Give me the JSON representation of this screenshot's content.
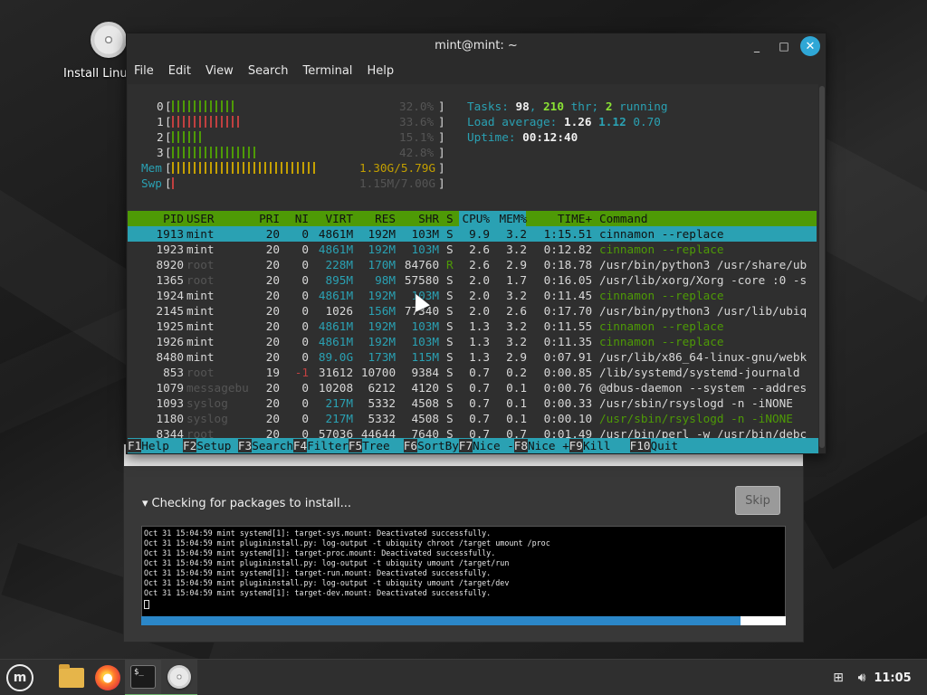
{
  "desktop": {
    "icon_label": "Install Linux Mint"
  },
  "installer": {
    "status": "Checking for packages to install...",
    "skip_label": "Skip",
    "progress_fraction": 0.93,
    "log": [
      "Oct 31 15:04:59 mint systemd[1]: target-sys.mount: Deactivated successfully.",
      "Oct 31 15:04:59 mint plugininstall.py: log-output -t ubiquity chroot /target umount /proc",
      "Oct 31 15:04:59 mint systemd[1]: target-proc.mount: Deactivated successfully.",
      "Oct 31 15:04:59 mint plugininstall.py: log-output -t ubiquity umount /target/run",
      "Oct 31 15:04:59 mint systemd[1]: target-run.mount: Deactivated successfully.",
      "Oct 31 15:04:59 mint plugininstall.py: log-output -t ubiquity umount /target/dev",
      "Oct 31 15:04:59 mint systemd[1]: target-dev.mount: Deactivated successfully."
    ]
  },
  "terminal": {
    "title": "mint@mint: ~",
    "menu": [
      "File",
      "Edit",
      "View",
      "Search",
      "Terminal",
      "Help"
    ]
  },
  "htop": {
    "meters": [
      {
        "label": "0",
        "value": "32.0%",
        "fill": 0.32
      },
      {
        "label": "1",
        "value": "33.6%",
        "fill": 0.34
      },
      {
        "label": "2",
        "value": "15.1%",
        "fill": 0.15
      },
      {
        "label": "3",
        "value": "42.8%",
        "fill": 0.43
      }
    ],
    "mem": {
      "label": "Mem",
      "value": "1.30G/5.79G",
      "fill": 0.72
    },
    "swp": {
      "label": "Swp",
      "value": "1.15M/7.00G",
      "fill": 0.01
    },
    "tasks": {
      "label": "Tasks:",
      "count": "98",
      "threads": "210",
      "thr_label": "thr;",
      "running": "2",
      "running_label": "running"
    },
    "load": {
      "label": "Load average:",
      "v1": "1.26",
      "v5": "1.12",
      "v15": "0.70"
    },
    "uptime": {
      "label": "Uptime:",
      "value": "00:12:40"
    },
    "columns": {
      "pid": "PID",
      "user": "USER",
      "pri": "PRI",
      "ni": "NI",
      "virt": "VIRT",
      "res": "RES",
      "shr": "SHR",
      "s": "S",
      "cpu": "CPU%",
      "mem": "MEM%",
      "time": "TIME+",
      "cmd": "Command"
    },
    "rows": [
      {
        "pid": "1913",
        "user": "mint",
        "pri": "20",
        "ni": "0",
        "virt": "4861M",
        "res": "192M",
        "shr": "103M",
        "s": "S",
        "cpu": "9.9",
        "mem": "3.2",
        "time": "1:15.51",
        "cmd": "cinnamon --replace"
      },
      {
        "pid": "1923",
        "user": "mint",
        "pri": "20",
        "ni": "0",
        "virt": "4861M",
        "res": "192M",
        "shr": "103M",
        "s": "S",
        "cpu": "2.6",
        "mem": "3.2",
        "time": "0:12.82",
        "cmd": "cinnamon --replace"
      },
      {
        "pid": "8920",
        "user": "root",
        "pri": "20",
        "ni": "0",
        "virt": "228M",
        "res": "170M",
        "shr": "84760",
        "s": "R",
        "cpu": "2.6",
        "mem": "2.9",
        "time": "0:18.78",
        "cmd": "/usr/bin/python3 /usr/share/ub"
      },
      {
        "pid": "1365",
        "user": "root",
        "pri": "20",
        "ni": "0",
        "virt": "895M",
        "res": "98M",
        "shr": "57580",
        "s": "S",
        "cpu": "2.0",
        "mem": "1.7",
        "time": "0:16.05",
        "cmd": "/usr/lib/xorg/Xorg -core :0 -s"
      },
      {
        "pid": "1924",
        "user": "mint",
        "pri": "20",
        "ni": "0",
        "virt": "4861M",
        "res": "192M",
        "shr": "103M",
        "s": "S",
        "cpu": "2.0",
        "mem": "3.2",
        "time": "0:11.45",
        "cmd": "cinnamon --replace"
      },
      {
        "pid": "2145",
        "user": "mint",
        "pri": "20",
        "ni": "0",
        "virt": "1026",
        "res": "156M",
        "shr": "77340",
        "s": "S",
        "cpu": "2.0",
        "mem": "2.6",
        "time": "0:17.70",
        "cmd": "/usr/bin/python3 /usr/lib/ubiq"
      },
      {
        "pid": "1925",
        "user": "mint",
        "pri": "20",
        "ni": "0",
        "virt": "4861M",
        "res": "192M",
        "shr": "103M",
        "s": "S",
        "cpu": "1.3",
        "mem": "3.2",
        "time": "0:11.55",
        "cmd": "cinnamon --replace"
      },
      {
        "pid": "1926",
        "user": "mint",
        "pri": "20",
        "ni": "0",
        "virt": "4861M",
        "res": "192M",
        "shr": "103M",
        "s": "S",
        "cpu": "1.3",
        "mem": "3.2",
        "time": "0:11.35",
        "cmd": "cinnamon --replace"
      },
      {
        "pid": "8480",
        "user": "mint",
        "pri": "20",
        "ni": "0",
        "virt": "89.0G",
        "res": "173M",
        "shr": "115M",
        "s": "S",
        "cpu": "1.3",
        "mem": "2.9",
        "time": "0:07.91",
        "cmd": "/usr/lib/x86_64-linux-gnu/webk"
      },
      {
        "pid": "853",
        "user": "root",
        "pri": "19",
        "ni": "-1",
        "virt": "31612",
        "res": "10700",
        "shr": "9384",
        "s": "S",
        "cpu": "0.7",
        "mem": "0.2",
        "time": "0:00.85",
        "cmd": "/lib/systemd/systemd-journald"
      },
      {
        "pid": "1079",
        "user": "messagebu",
        "pri": "20",
        "ni": "0",
        "virt": "10208",
        "res": "6212",
        "shr": "4120",
        "s": "S",
        "cpu": "0.7",
        "mem": "0.1",
        "time": "0:00.76",
        "cmd": "@dbus-daemon --system --addres"
      },
      {
        "pid": "1093",
        "user": "syslog",
        "pri": "20",
        "ni": "0",
        "virt": "217M",
        "res": "5332",
        "shr": "4508",
        "s": "S",
        "cpu": "0.7",
        "mem": "0.1",
        "time": "0:00.33",
        "cmd": "/usr/sbin/rsyslogd -n -iNONE"
      },
      {
        "pid": "1180",
        "user": "syslog",
        "pri": "20",
        "ni": "0",
        "virt": "217M",
        "res": "5332",
        "shr": "4508",
        "s": "S",
        "cpu": "0.7",
        "mem": "0.1",
        "time": "0:00.10",
        "cmd": "/usr/sbin/rsyslogd -n -iNONE"
      },
      {
        "pid": "8344",
        "user": "root",
        "pri": "20",
        "ni": "0",
        "virt": "57036",
        "res": "44644",
        "shr": "7640",
        "s": "S",
        "cpu": "0.7",
        "mem": "0.7",
        "time": "0:01.49",
        "cmd": "/usr/bin/perl -w /usr/bin/debc"
      }
    ],
    "fkeys": [
      {
        "key": "F1",
        "label": "Help  "
      },
      {
        "key": "F2",
        "label": "Setup "
      },
      {
        "key": "F3",
        "label": "Search"
      },
      {
        "key": "F4",
        "label": "Filter"
      },
      {
        "key": "F5",
        "label": "Tree  "
      },
      {
        "key": "F6",
        "label": "SortBy"
      },
      {
        "key": "F7",
        "label": "Nice -"
      },
      {
        "key": "F8",
        "label": "Nice +"
      },
      {
        "key": "F9",
        "label": "Kill  "
      },
      {
        "key": "F10",
        "label": "Quit"
      }
    ]
  },
  "taskbar": {
    "menu_icon": "mint-menu-icon",
    "apps": [
      "files-icon",
      "firefox-icon",
      "terminal-icon",
      "installer-disc-icon"
    ],
    "clock": "11:05"
  },
  "colors": {
    "accent": "#2aa1b3",
    "header_green": "#4e9a06",
    "close_button": "#2fa7d6",
    "progress": "#2b87c8"
  }
}
